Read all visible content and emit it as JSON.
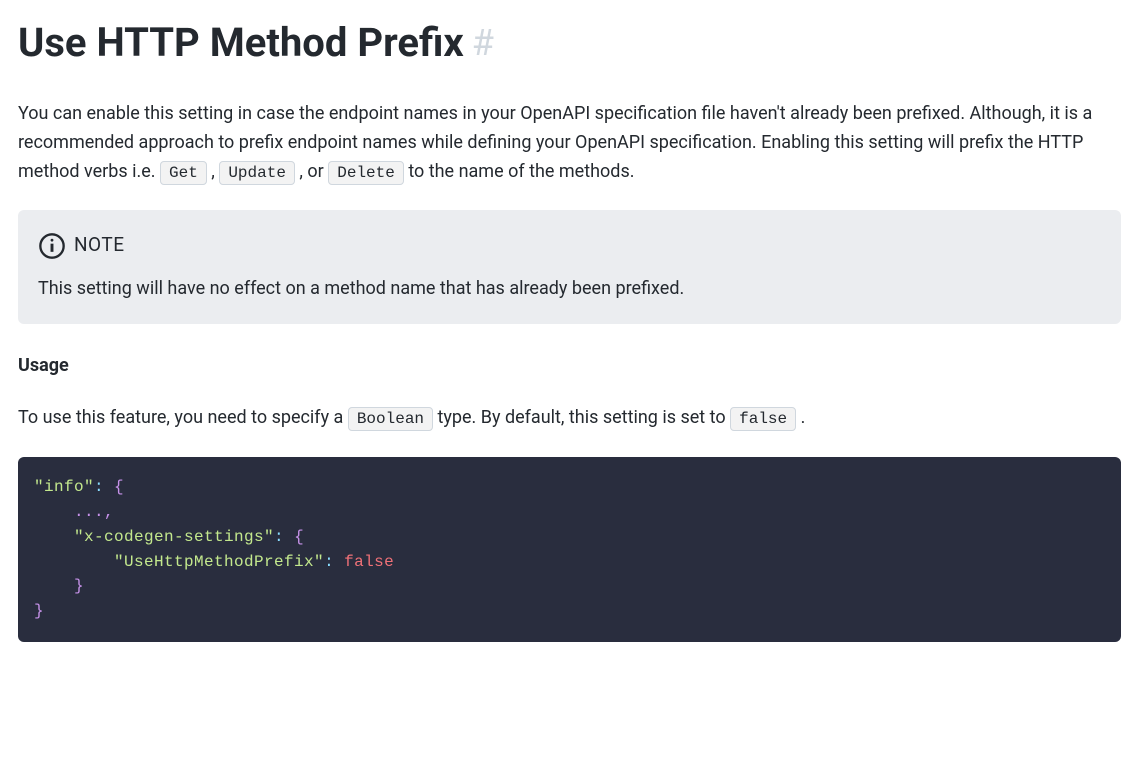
{
  "page": {
    "title": "Use HTTP Method Prefix",
    "anchor": "#"
  },
  "intro": {
    "text_1": "You can enable this setting in case the endpoint names in your OpenAPI specification file haven't already been prefixed. Although, it is a recommended approach to prefix endpoint names while defining your OpenAPI specification. Enabling this setting will prefix the HTTP method verbs i.e. ",
    "code_get": "Get",
    "sep_1": " , ",
    "code_update": "Update",
    "sep_2": " , or ",
    "code_delete": "Delete",
    "text_2": "  to the name of the methods."
  },
  "note": {
    "label": "NOTE",
    "body": "This setting will have no effect on a method name that has already been prefixed."
  },
  "usage": {
    "heading": "Usage",
    "text_1": "To use this feature, you need to specify a ",
    "code_boolean": "Boolean",
    "text_2": "  type. By default, this setting is set to ",
    "code_false": "false",
    "text_3": " ."
  },
  "code": {
    "line1_key": "\"info\"",
    "line1_colon": ": ",
    "line1_brace": "{",
    "line2_dots": "    ...,",
    "line3_indent": "    ",
    "line3_key": "\"x-codegen-settings\"",
    "line3_colon": ": ",
    "line3_brace": "{",
    "line4_indent": "        ",
    "line4_key": "\"UseHttpMethodPrefix\"",
    "line4_colon": ": ",
    "line4_val": "false",
    "line5_brace": "    }",
    "line6_brace": "}"
  }
}
